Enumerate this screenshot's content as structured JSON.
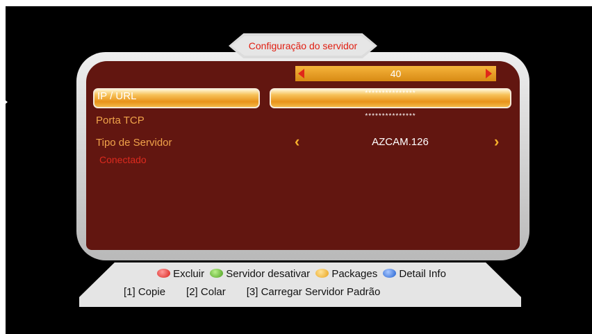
{
  "title": "Configuração do servidor",
  "server_number": "40",
  "fields": {
    "ip_url": {
      "label": "IP / URL",
      "value": "***************"
    },
    "tcp_port": {
      "label": "Porta TCP",
      "value": "***************"
    },
    "server_type": {
      "label": "Tipo de Servidor",
      "value": "AZCAM.126"
    }
  },
  "status": "Conectado",
  "legend": {
    "red": "Excluir",
    "green": "Servidor desativar",
    "yellow": "Packages",
    "blue": "Detail Info"
  },
  "keys": [
    "[1] Copie",
    "[2] Colar",
    "[3] Carregar Servidor Padrão"
  ],
  "colors": {
    "panel_bg": "#621610",
    "label": "#f0a34a",
    "accent": "#f6b02c",
    "status": "#dd2a1e",
    "title": "#e01d10"
  }
}
